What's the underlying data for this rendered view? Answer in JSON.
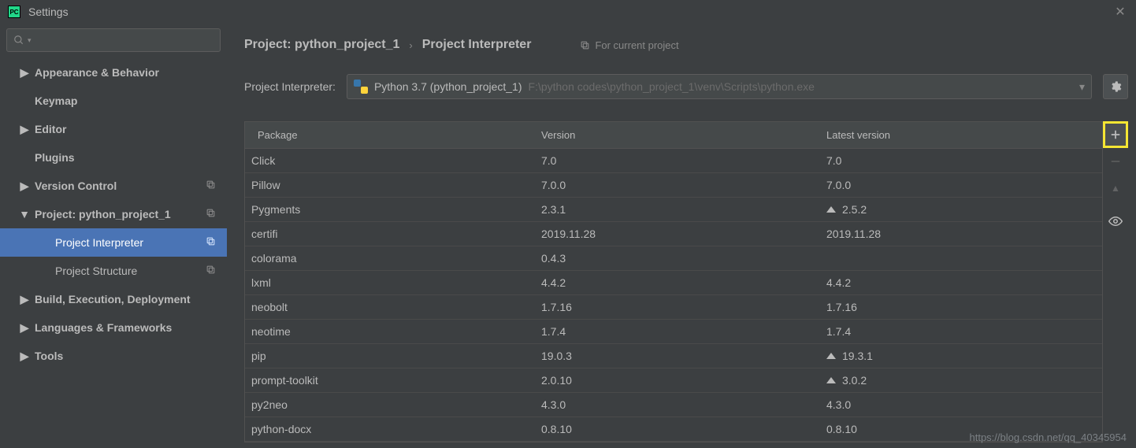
{
  "title": "Settings",
  "app_icon_text": "PC",
  "search_placeholder": "",
  "sidebar": [
    {
      "label": "Appearance & Behavior",
      "arrow": "right",
      "sub": false,
      "selected": false,
      "copy": false
    },
    {
      "label": "Keymap",
      "arrow": "none",
      "sub": false,
      "selected": false,
      "copy": false
    },
    {
      "label": "Editor",
      "arrow": "right",
      "sub": false,
      "selected": false,
      "copy": false
    },
    {
      "label": "Plugins",
      "arrow": "none",
      "sub": false,
      "selected": false,
      "copy": false
    },
    {
      "label": "Version Control",
      "arrow": "right",
      "sub": false,
      "selected": false,
      "copy": true
    },
    {
      "label": "Project: python_project_1",
      "arrow": "down",
      "sub": false,
      "selected": false,
      "copy": true
    },
    {
      "label": "Project Interpreter",
      "arrow": "none",
      "sub": true,
      "selected": true,
      "copy": true
    },
    {
      "label": "Project Structure",
      "arrow": "none",
      "sub": true,
      "selected": false,
      "copy": true
    },
    {
      "label": "Build, Execution, Deployment",
      "arrow": "right",
      "sub": false,
      "selected": false,
      "copy": false
    },
    {
      "label": "Languages & Frameworks",
      "arrow": "right",
      "sub": false,
      "selected": false,
      "copy": false
    },
    {
      "label": "Tools",
      "arrow": "right",
      "sub": false,
      "selected": false,
      "copy": false
    }
  ],
  "breadcrumb": {
    "project": "Project: python_project_1",
    "page": "Project Interpreter",
    "for_current": "For current project"
  },
  "interpreter": {
    "label": "Project Interpreter:",
    "name": "Python 3.7 (python_project_1)",
    "path": "F:\\python codes\\python_project_1\\venv\\Scripts\\python.exe"
  },
  "table": {
    "headers": {
      "package": "Package",
      "version": "Version",
      "latest": "Latest version"
    },
    "rows": [
      {
        "pkg": "Click",
        "ver": "7.0",
        "lat": "7.0",
        "upgrade": false
      },
      {
        "pkg": "Pillow",
        "ver": "7.0.0",
        "lat": "7.0.0",
        "upgrade": false
      },
      {
        "pkg": "Pygments",
        "ver": "2.3.1",
        "lat": "2.5.2",
        "upgrade": true
      },
      {
        "pkg": "certifi",
        "ver": "2019.11.28",
        "lat": "2019.11.28",
        "upgrade": false
      },
      {
        "pkg": "colorama",
        "ver": "0.4.3",
        "lat": "",
        "upgrade": false
      },
      {
        "pkg": "lxml",
        "ver": "4.4.2",
        "lat": "4.4.2",
        "upgrade": false
      },
      {
        "pkg": "neobolt",
        "ver": "1.7.16",
        "lat": "1.7.16",
        "upgrade": false
      },
      {
        "pkg": "neotime",
        "ver": "1.7.4",
        "lat": "1.7.4",
        "upgrade": false
      },
      {
        "pkg": "pip",
        "ver": "19.0.3",
        "lat": "19.3.1",
        "upgrade": true
      },
      {
        "pkg": "prompt-toolkit",
        "ver": "2.0.10",
        "lat": "3.0.2",
        "upgrade": true
      },
      {
        "pkg": "py2neo",
        "ver": "4.3.0",
        "lat": "4.3.0",
        "upgrade": false
      },
      {
        "pkg": "python-docx",
        "ver": "0.8.10",
        "lat": "0.8.10",
        "upgrade": false
      }
    ]
  },
  "watermark": "https://blog.csdn.net/qq_40345954"
}
